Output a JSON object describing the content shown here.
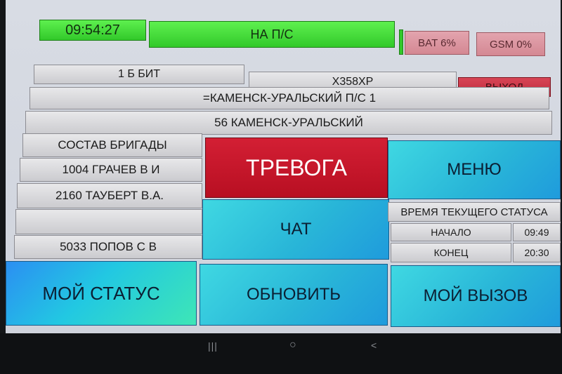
{
  "status_bar": {
    "clock": "09:54:27",
    "status": "НА П/С",
    "battery": "BAT 6%",
    "gsm": "GSM 0%"
  },
  "info": {
    "brigade": "1 Б  БИТ",
    "vehicle": "Х358ХР",
    "exit_button": "ВЫХОД",
    "station": "=КАМЕНСК-УРАЛЬСКИЙ П/С 1",
    "substation": "56  КАМЕНСК-УРАЛЬСКИЙ"
  },
  "crew": {
    "header": "СОСТАВ БРИГАДЫ",
    "members": [
      "1004 ГРАЧЕВ В И",
      "2160 ТАУБЕРТ В.А.",
      "",
      "5033 ПОПОВ С В"
    ]
  },
  "buttons": {
    "alarm": "ТРЕВОГА",
    "menu": "МЕНЮ",
    "chat": "ЧАТ",
    "my_status": "МОЙ СТАТУС",
    "refresh": "ОБНОВИТЬ",
    "my_call": "МОЙ ВЫЗОВ"
  },
  "status_time": {
    "header": "ВРЕМЯ ТЕКУЩЕГО СТАТУСА",
    "start_label": "НАЧАЛО",
    "start_value": "09:49",
    "end_label": "КОНЕЦ",
    "end_value": "20:30"
  },
  "nav": {
    "recent": "|||",
    "home": "○",
    "back": "<"
  }
}
